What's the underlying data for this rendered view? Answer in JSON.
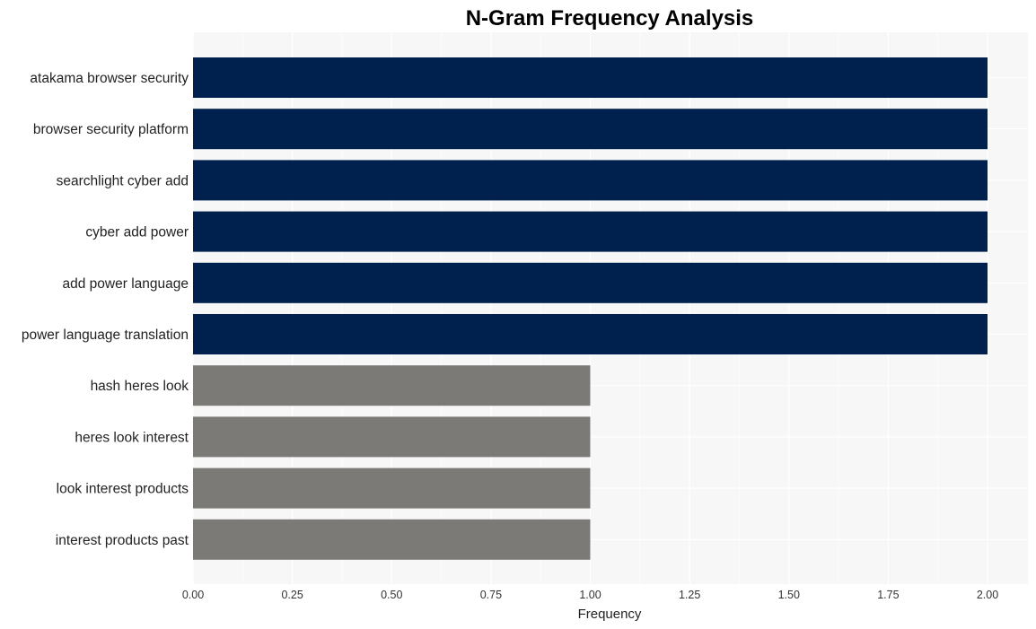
{
  "chart_data": {
    "type": "bar",
    "orientation": "horizontal",
    "title": "N-Gram Frequency Analysis",
    "xlabel": "Frequency",
    "ylabel": "",
    "xlim": [
      0,
      2.1
    ],
    "x_ticks": [
      "0.00",
      "0.25",
      "0.50",
      "0.75",
      "1.00",
      "1.25",
      "1.50",
      "1.75",
      "2.00"
    ],
    "x_tick_values": [
      0,
      0.25,
      0.5,
      0.75,
      1.0,
      1.25,
      1.5,
      1.75,
      2.0
    ],
    "grid": true,
    "categories": [
      "atakama browser security",
      "browser security platform",
      "searchlight cyber add",
      "cyber add power",
      "add power language",
      "power language translation",
      "hash heres look",
      "heres look interest",
      "look interest products",
      "interest products past"
    ],
    "values": [
      2,
      2,
      2,
      2,
      2,
      2,
      1,
      1,
      1,
      1
    ],
    "colors": {
      "high": "#00214d",
      "low": "#7b7a76",
      "panel_bg": "#f7f7f7",
      "grid": "#ffffff"
    }
  }
}
